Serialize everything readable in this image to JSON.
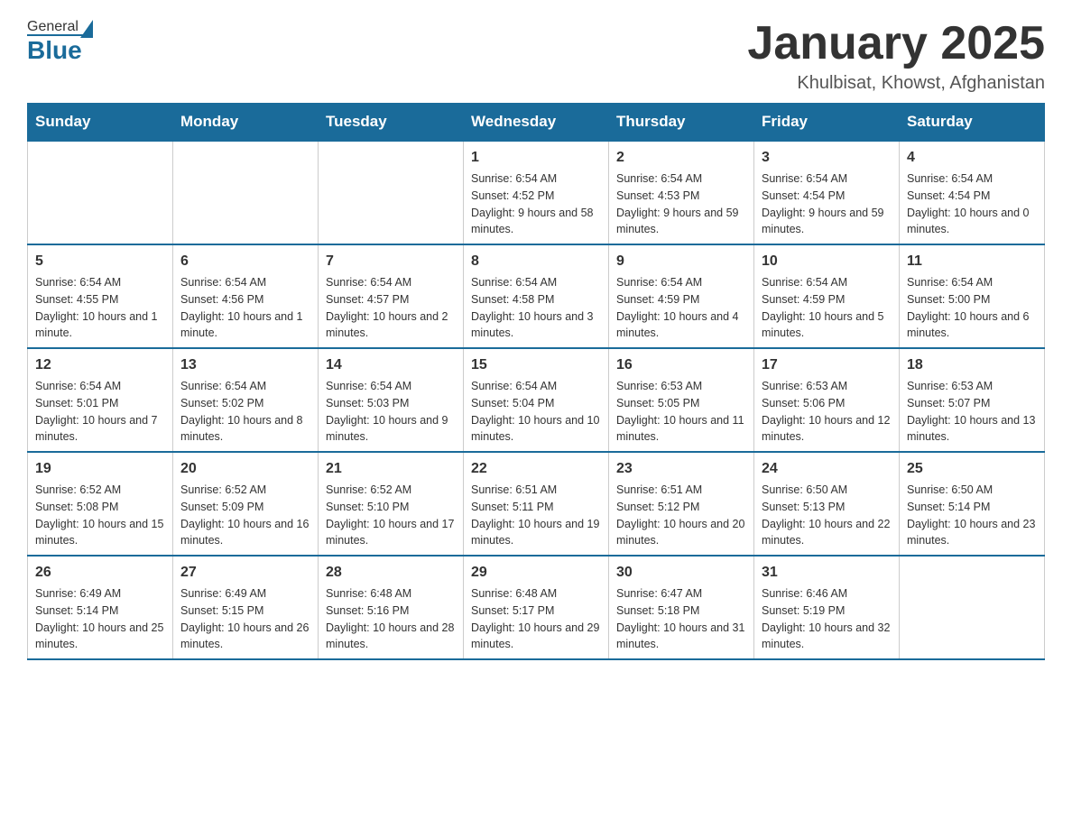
{
  "header": {
    "logo_general": "General",
    "logo_blue": "Blue",
    "month_title": "January 2025",
    "location": "Khulbisat, Khowst, Afghanistan"
  },
  "weekdays": [
    "Sunday",
    "Monday",
    "Tuesday",
    "Wednesday",
    "Thursday",
    "Friday",
    "Saturday"
  ],
  "weeks": [
    [
      {
        "day": "",
        "sunrise": "",
        "sunset": "",
        "daylight": ""
      },
      {
        "day": "",
        "sunrise": "",
        "sunset": "",
        "daylight": ""
      },
      {
        "day": "",
        "sunrise": "",
        "sunset": "",
        "daylight": ""
      },
      {
        "day": "1",
        "sunrise": "Sunrise: 6:54 AM",
        "sunset": "Sunset: 4:52 PM",
        "daylight": "Daylight: 9 hours and 58 minutes."
      },
      {
        "day": "2",
        "sunrise": "Sunrise: 6:54 AM",
        "sunset": "Sunset: 4:53 PM",
        "daylight": "Daylight: 9 hours and 59 minutes."
      },
      {
        "day": "3",
        "sunrise": "Sunrise: 6:54 AM",
        "sunset": "Sunset: 4:54 PM",
        "daylight": "Daylight: 9 hours and 59 minutes."
      },
      {
        "day": "4",
        "sunrise": "Sunrise: 6:54 AM",
        "sunset": "Sunset: 4:54 PM",
        "daylight": "Daylight: 10 hours and 0 minutes."
      }
    ],
    [
      {
        "day": "5",
        "sunrise": "Sunrise: 6:54 AM",
        "sunset": "Sunset: 4:55 PM",
        "daylight": "Daylight: 10 hours and 1 minute."
      },
      {
        "day": "6",
        "sunrise": "Sunrise: 6:54 AM",
        "sunset": "Sunset: 4:56 PM",
        "daylight": "Daylight: 10 hours and 1 minute."
      },
      {
        "day": "7",
        "sunrise": "Sunrise: 6:54 AM",
        "sunset": "Sunset: 4:57 PM",
        "daylight": "Daylight: 10 hours and 2 minutes."
      },
      {
        "day": "8",
        "sunrise": "Sunrise: 6:54 AM",
        "sunset": "Sunset: 4:58 PM",
        "daylight": "Daylight: 10 hours and 3 minutes."
      },
      {
        "day": "9",
        "sunrise": "Sunrise: 6:54 AM",
        "sunset": "Sunset: 4:59 PM",
        "daylight": "Daylight: 10 hours and 4 minutes."
      },
      {
        "day": "10",
        "sunrise": "Sunrise: 6:54 AM",
        "sunset": "Sunset: 4:59 PM",
        "daylight": "Daylight: 10 hours and 5 minutes."
      },
      {
        "day": "11",
        "sunrise": "Sunrise: 6:54 AM",
        "sunset": "Sunset: 5:00 PM",
        "daylight": "Daylight: 10 hours and 6 minutes."
      }
    ],
    [
      {
        "day": "12",
        "sunrise": "Sunrise: 6:54 AM",
        "sunset": "Sunset: 5:01 PM",
        "daylight": "Daylight: 10 hours and 7 minutes."
      },
      {
        "day": "13",
        "sunrise": "Sunrise: 6:54 AM",
        "sunset": "Sunset: 5:02 PM",
        "daylight": "Daylight: 10 hours and 8 minutes."
      },
      {
        "day": "14",
        "sunrise": "Sunrise: 6:54 AM",
        "sunset": "Sunset: 5:03 PM",
        "daylight": "Daylight: 10 hours and 9 minutes."
      },
      {
        "day": "15",
        "sunrise": "Sunrise: 6:54 AM",
        "sunset": "Sunset: 5:04 PM",
        "daylight": "Daylight: 10 hours and 10 minutes."
      },
      {
        "day": "16",
        "sunrise": "Sunrise: 6:53 AM",
        "sunset": "Sunset: 5:05 PM",
        "daylight": "Daylight: 10 hours and 11 minutes."
      },
      {
        "day": "17",
        "sunrise": "Sunrise: 6:53 AM",
        "sunset": "Sunset: 5:06 PM",
        "daylight": "Daylight: 10 hours and 12 minutes."
      },
      {
        "day": "18",
        "sunrise": "Sunrise: 6:53 AM",
        "sunset": "Sunset: 5:07 PM",
        "daylight": "Daylight: 10 hours and 13 minutes."
      }
    ],
    [
      {
        "day": "19",
        "sunrise": "Sunrise: 6:52 AM",
        "sunset": "Sunset: 5:08 PM",
        "daylight": "Daylight: 10 hours and 15 minutes."
      },
      {
        "day": "20",
        "sunrise": "Sunrise: 6:52 AM",
        "sunset": "Sunset: 5:09 PM",
        "daylight": "Daylight: 10 hours and 16 minutes."
      },
      {
        "day": "21",
        "sunrise": "Sunrise: 6:52 AM",
        "sunset": "Sunset: 5:10 PM",
        "daylight": "Daylight: 10 hours and 17 minutes."
      },
      {
        "day": "22",
        "sunrise": "Sunrise: 6:51 AM",
        "sunset": "Sunset: 5:11 PM",
        "daylight": "Daylight: 10 hours and 19 minutes."
      },
      {
        "day": "23",
        "sunrise": "Sunrise: 6:51 AM",
        "sunset": "Sunset: 5:12 PM",
        "daylight": "Daylight: 10 hours and 20 minutes."
      },
      {
        "day": "24",
        "sunrise": "Sunrise: 6:50 AM",
        "sunset": "Sunset: 5:13 PM",
        "daylight": "Daylight: 10 hours and 22 minutes."
      },
      {
        "day": "25",
        "sunrise": "Sunrise: 6:50 AM",
        "sunset": "Sunset: 5:14 PM",
        "daylight": "Daylight: 10 hours and 23 minutes."
      }
    ],
    [
      {
        "day": "26",
        "sunrise": "Sunrise: 6:49 AM",
        "sunset": "Sunset: 5:14 PM",
        "daylight": "Daylight: 10 hours and 25 minutes."
      },
      {
        "day": "27",
        "sunrise": "Sunrise: 6:49 AM",
        "sunset": "Sunset: 5:15 PM",
        "daylight": "Daylight: 10 hours and 26 minutes."
      },
      {
        "day": "28",
        "sunrise": "Sunrise: 6:48 AM",
        "sunset": "Sunset: 5:16 PM",
        "daylight": "Daylight: 10 hours and 28 minutes."
      },
      {
        "day": "29",
        "sunrise": "Sunrise: 6:48 AM",
        "sunset": "Sunset: 5:17 PM",
        "daylight": "Daylight: 10 hours and 29 minutes."
      },
      {
        "day": "30",
        "sunrise": "Sunrise: 6:47 AM",
        "sunset": "Sunset: 5:18 PM",
        "daylight": "Daylight: 10 hours and 31 minutes."
      },
      {
        "day": "31",
        "sunrise": "Sunrise: 6:46 AM",
        "sunset": "Sunset: 5:19 PM",
        "daylight": "Daylight: 10 hours and 32 minutes."
      },
      {
        "day": "",
        "sunrise": "",
        "sunset": "",
        "daylight": ""
      }
    ]
  ]
}
